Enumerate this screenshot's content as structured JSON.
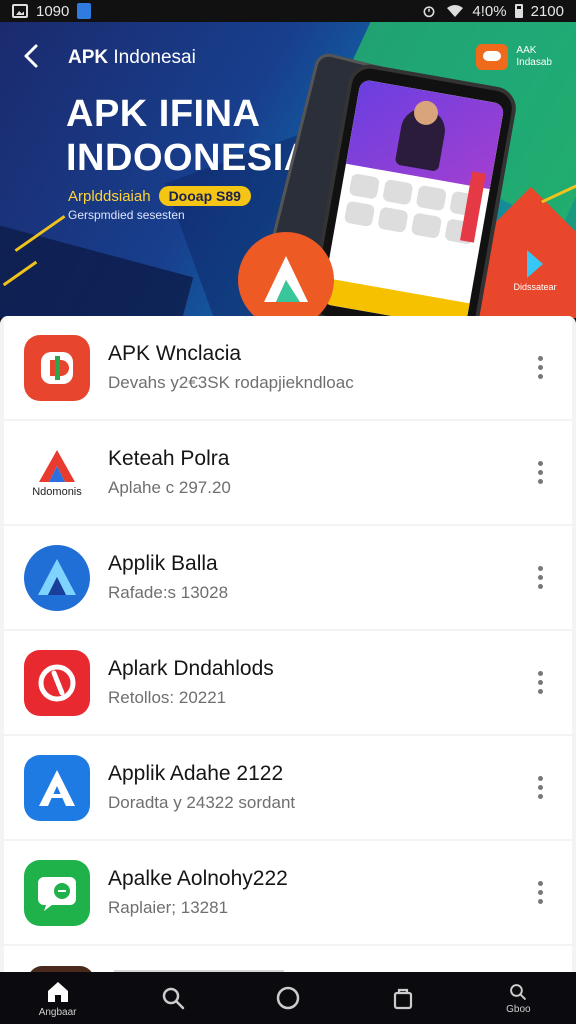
{
  "status_bar": {
    "time_left": "1090",
    "battery_text": "4!0%",
    "time_right": "2100"
  },
  "banner": {
    "brand_bold": "APK",
    "brand_rest": "Indonesai",
    "title_line1": "APK IFINA",
    "title_line2": "INDOONESIA",
    "subtitle": "Arplddsiaiah",
    "pill": "Dooap S89",
    "subtitle2": "Gerspmdied sesesten",
    "corner_badge_line1": "AAK",
    "corner_badge_line2": "Indasab",
    "play_corner_label": "Didssatear"
  },
  "apps": [
    {
      "name": "APK Wnclacia",
      "meta": "Devahs y2€3SK rodapjiekndloac",
      "icon": "app-icon-1",
      "color": "#e8452e"
    },
    {
      "name": "Keteah Polra",
      "meta": "Aplahe c 297.20",
      "icon": "app-icon-2",
      "color": "#ffffff",
      "icon_label": "Ndomonis"
    },
    {
      "name": "Applik Balla",
      "meta": "Rafade:s 13028",
      "icon": "app-icon-3",
      "color": "#1f6fd6"
    },
    {
      "name": "Aplark Dndahlods",
      "meta": "Retollos: 20221",
      "icon": "app-icon-4",
      "color": "#e8292f"
    },
    {
      "name": "Applik Adahe 2122",
      "meta": "Doradta y 24322 sordant",
      "icon": "app-icon-5",
      "color": "#1e7be3"
    },
    {
      "name": "Apalke Aolnohy222",
      "meta": "Raplaier; 13281",
      "icon": "app-icon-6",
      "color": "#1fb24a"
    }
  ],
  "bottom_nav": [
    {
      "label": "Angbaar",
      "icon": "home-icon"
    },
    {
      "label": "",
      "icon": "search-icon"
    },
    {
      "label": "",
      "icon": "circle-home-icon"
    },
    {
      "label": "",
      "icon": "bag-icon"
    },
    {
      "label": "Gboo",
      "icon": "search-small-icon"
    }
  ]
}
